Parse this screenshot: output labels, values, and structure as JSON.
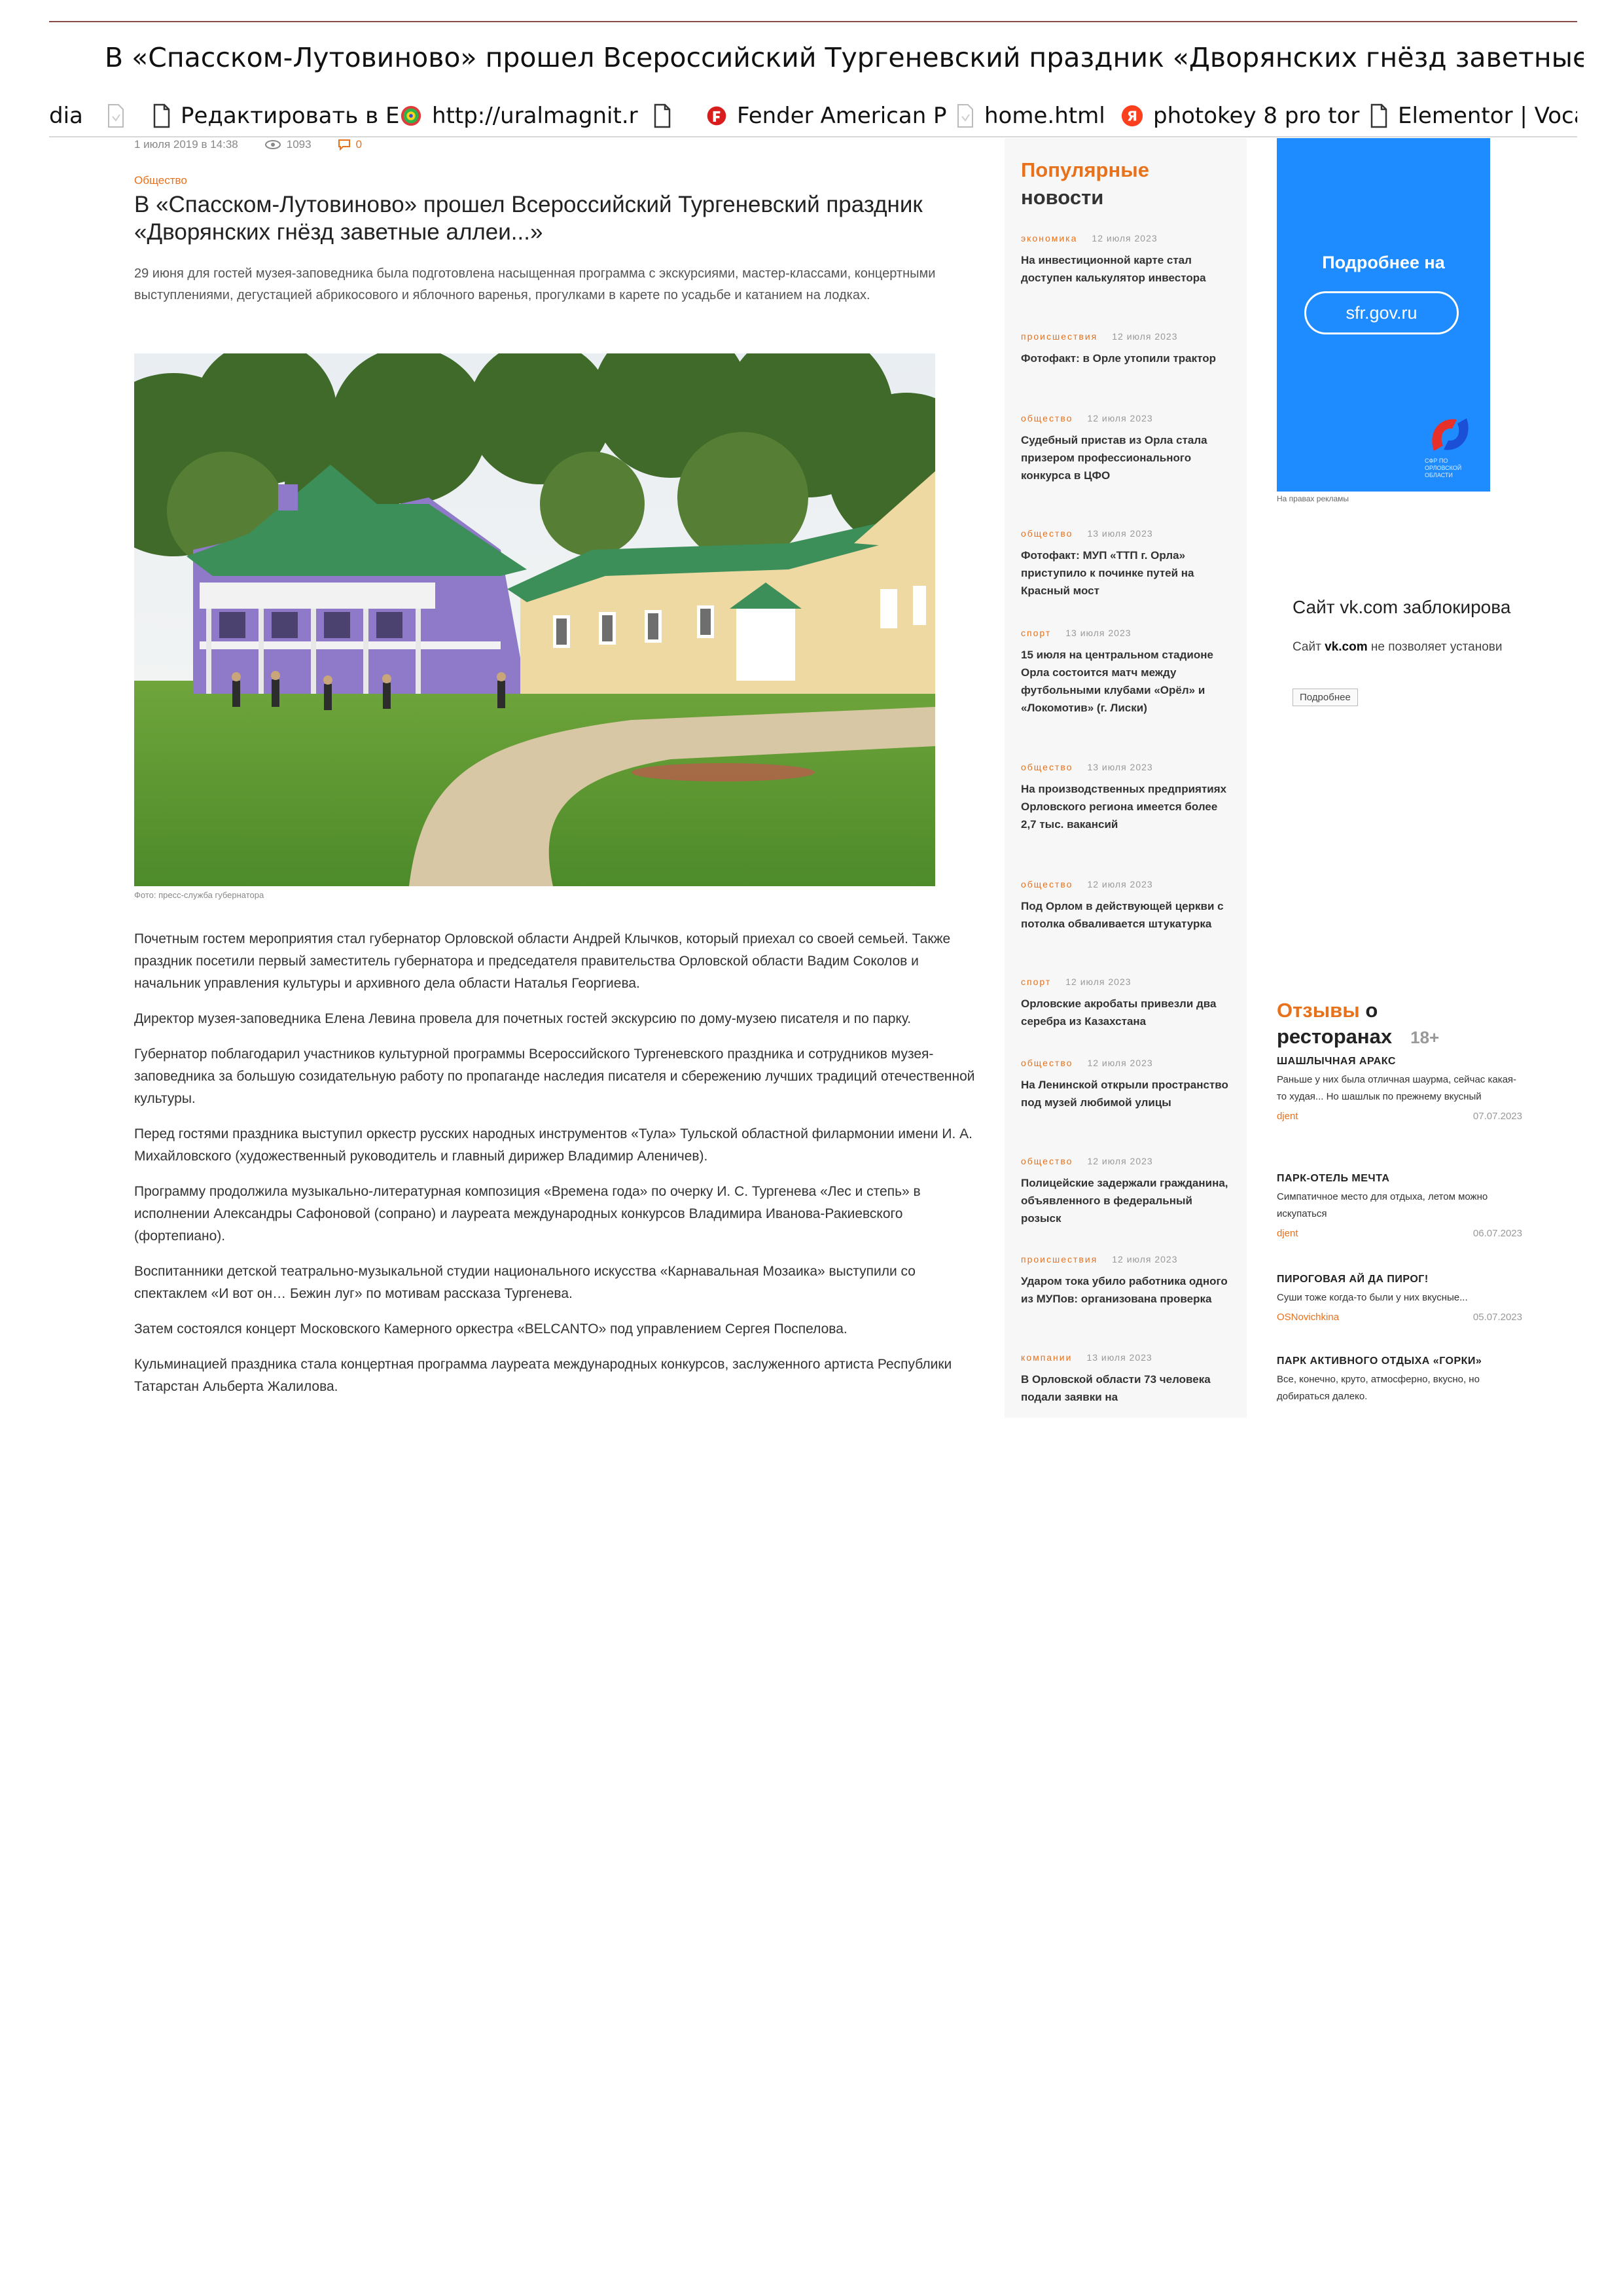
{
  "browser": {
    "window_title": "В «Спасском-Лутовиново» прошел Всероссийский Тургеневский праздник «Дворянских гнёзд заветные аллеи...»",
    "bookmarks": [
      {
        "label": "dia",
        "icon": "none"
      },
      {
        "label": "",
        "icon": "page-icon"
      },
      {
        "label": "Редактировать в E",
        "icon": "page-icon"
      },
      {
        "label": "http://uralmagnit.r",
        "icon": "globe-icon"
      },
      {
        "label": "",
        "icon": "page-icon"
      },
      {
        "label": "Fender American P",
        "icon": "fender-icon"
      },
      {
        "label": "home.html",
        "icon": "page-icon"
      },
      {
        "label": "photokey 8 pro tor",
        "icon": "yandex-icon"
      },
      {
        "label": "Elementor | Voca",
        "icon": "page-icon"
      }
    ]
  },
  "article": {
    "date": "1 июля 2019 в 14:38",
    "views": "1093",
    "comments": "0",
    "category": "Общество",
    "title": "В «Спасском-Лутовиново» прошел Всероссийский Тургеневский праздник «Дворянских гнёзд заветные аллеи...»",
    "lead": "29 июня для гостей музея-заповедника была подготовлена насыщенная программа с экскурсиями, мастер-классами, концертными выступлениями, дегустацией абрикосового и яблочного варенья, прогулками в карете по усадьбе и катанием на лодках.",
    "photo_caption": "Фото: пресс-служба губернатора",
    "paragraphs": [
      "Почетным гостем мероприятия стал губернатор Орловской области Андрей Клычков, который приехал со своей семьей. Также праздник посетили первый заместитель губернатора и председателя правительства Орловской области Вадим Соколов и начальник управления культуры и архивного дела области Наталья Георгиева.",
      "Директор музея-заповедника Елена Левина провела для почетных гостей экскурсию по дому-музею писателя и по парку.",
      "Губернатор поблагодарил участников культурной программы Всероссийского Тургеневского праздника и сотрудников музея-заповедника за большую созидательную работу по пропаганде наследия писателя и сбережению лучших традиций отечественной культуры.",
      "Перед гостями праздника выступил оркестр русских народных инструментов «Тула» Тульской областной филармонии имени И. А. Михайловского (художественный руководитель и главный дирижер Владимир Аленичев).",
      "Программу продолжила музыкально-литературная композиция «Времена года» по очерку И. С. Тургенева «Лес и степь» в исполнении Александры Сафоновой (сопрано) и лауреата международных конкурсов Владимира Иванова-Ракиевского (фортепиано).",
      "Воспитанники детской театрально-музыкальной студии национального искусства «Карнавальная Мозаика» выступили со спектаклем «И вот он… Бежин луг» по мотивам рассказа Тургенева.",
      "Затем состоялся концерт Московского Камерного оркестра «BELCANTO» под управлением Сергея Поспелова.",
      "Кульминацией праздника стала концертная программа лауреата международных конкурсов, заслуженного артиста Республики Татарстан Альберта Жалилова."
    ]
  },
  "popular": {
    "heading_1": "Популярные",
    "heading_2": "новости",
    "items": [
      {
        "tag": "экономика",
        "date": "12 июля 2023",
        "text": "На инвестиционной карте стал доступен калькулятор инвестора"
      },
      {
        "tag": "происшествия",
        "date": "12 июля 2023",
        "text": "Фотофакт: в Орле утопили трактор"
      },
      {
        "tag": "общество",
        "date": "12 июля 2023",
        "text": "Судебный пристав из Орла стала призером профессионального конкурса в ЦФО"
      },
      {
        "tag": "общество",
        "date": "13 июля 2023",
        "text": "Фотофакт: МУП «ТТП г. Орла» приступило к починке путей на Красный мост"
      },
      {
        "tag": "спорт",
        "date": "13 июля 2023",
        "text": "15 июля на центральном стадионе Орла состоится матч между футбольными клубами «Орёл» и «Локомотив» (г. Лиски)"
      },
      {
        "tag": "общество",
        "date": "13 июля 2023",
        "text": "На производственных предприятиях Орловского региона имеется более 2,7 тыс. вакансий"
      },
      {
        "tag": "общество",
        "date": "12 июля 2023",
        "text": "Под Орлом в действующей церкви с потолка обваливается штукатурка"
      },
      {
        "tag": "спорт",
        "date": "12 июля 2023",
        "text": "Орловские акробаты привезли два серебра из Казахстана"
      },
      {
        "tag": "общество",
        "date": "12 июля 2023",
        "text": "На Ленинской открыли пространство под музей любимой улицы"
      },
      {
        "tag": "общество",
        "date": "12 июля 2023",
        "text": "Полицейские задержали гражданина, объявленного в федеральный розыск"
      },
      {
        "tag": "происшествия",
        "date": "12 июля 2023",
        "text": "Ударом тока убило работника одного из МУПов: организована проверка"
      },
      {
        "tag": "компании",
        "date": "13 июля 2023",
        "text": "В Орловской области 73 человека подали заявки на"
      }
    ]
  },
  "ad": {
    "more_label": "Подробнее на",
    "button_label": "sfr.gov.ru",
    "logo_sub": "СФР ПО ОРЛОВСКОЙ ОБЛАСТИ",
    "note": "На правах рекламы",
    "brand_color": "#1e8cff",
    "logo_colors": [
      "#e8302a",
      "#1a4fd6"
    ]
  },
  "vk": {
    "title": "Сайт vk.com заблокирова",
    "text_prefix": "Сайт ",
    "text_bold": "vk.com",
    "text_suffix": " не позволяет установи",
    "button": "Подробнее"
  },
  "reviews": {
    "heading_orange": "Отзывы",
    "heading_rest": " о ресторанах",
    "age": "18+",
    "items": [
      {
        "name": "ШАШЛЫЧНАЯ АРАКС",
        "text": "Раньше у них была отличная шаурма, сейчас какая-то худая... Но шашлык по прежнему вкусный",
        "user": "djent",
        "date": "07.07.2023"
      },
      {
        "name": "ПАРК-ОТЕЛЬ МЕЧТА",
        "text": "Симпатичное место для отдыха, летом можно искупаться",
        "user": "djent",
        "date": "06.07.2023"
      },
      {
        "name": "ПИРОГОВАЯ АЙ ДА ПИРОГ!",
        "text": "Суши тоже когда-то были у них вкусные...",
        "user": "OSNovichkina",
        "date": "05.07.2023"
      },
      {
        "name": "ПАРК АКТИВНОГО ОТДЫХА «ГОРКИ»",
        "text": "Все, конечно, круто, атмосферно, вкусно, но добираться далеко.",
        "user": "",
        "date": ""
      }
    ]
  },
  "colors": {
    "accent": "#e8711c",
    "sidebar_bg": "#f7f7f7"
  }
}
